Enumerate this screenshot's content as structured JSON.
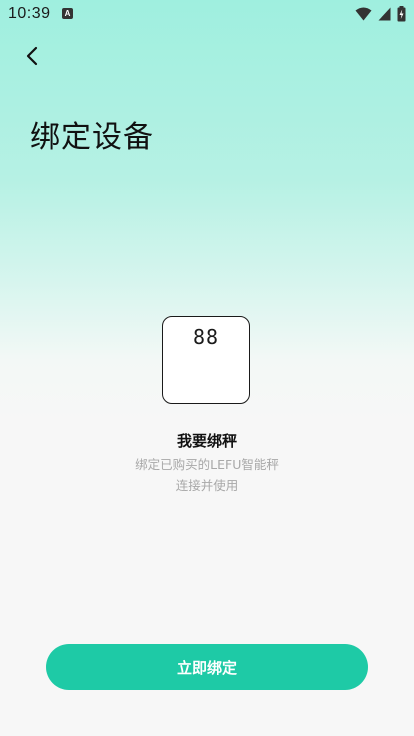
{
  "status_bar": {
    "time": "10:39",
    "notification_letter": "A",
    "icons": [
      "wifi-icon",
      "cell-signal-icon",
      "battery-icon"
    ]
  },
  "header": {
    "back_icon": "chevron-left-icon",
    "title": "绑定设备"
  },
  "device": {
    "display_digits": "88",
    "name": "我要绑秤",
    "description_line1": "绑定已购买的LEFU智能秤",
    "description_line2": "连接并使用"
  },
  "actions": {
    "bind_label": "立即绑定"
  },
  "colors": {
    "accent": "#1ecaa6",
    "gradient_top": "#9fefdf",
    "background": "#f7f7f7"
  }
}
